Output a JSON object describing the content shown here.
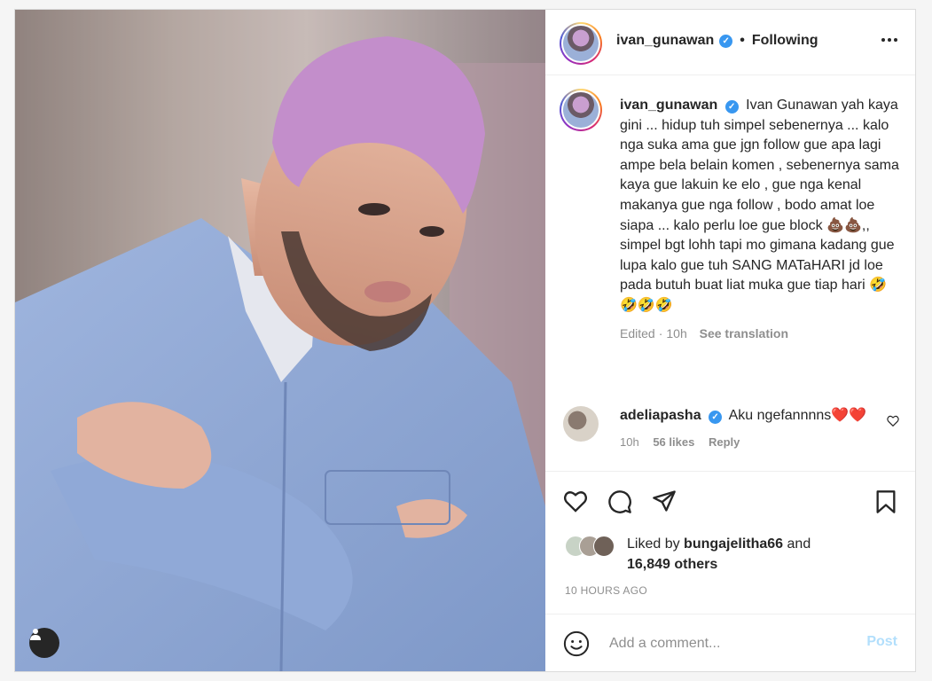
{
  "post": {
    "username": "ivan_gunawan",
    "follow_status": "Following",
    "caption_user": "ivan_gunawan",
    "caption_text": "Ivan Gunawan yah kaya gini ... hidup tuh simpel sebenernya ... kalo nga suka ama gue jgn follow gue apa lagi ampe bela belain komen , sebenernya sama kaya gue lakuin ke elo , gue nga kenal makanya gue nga follow , bodo amat loe siapa ... kalo perlu loe gue block 💩💩,, simpel bgt lohh tapi mo gimana kadang gue lupa kalo gue tuh SANG MATaHARI jd loe pada butuh buat liat muka gue tiap hari 🤣🤣🤣🤣",
    "edited_label": "Edited",
    "edited_time": "10h",
    "see_translation": "See translation",
    "comment": {
      "user": "adeliapasha",
      "text": "Aku ngefannnns❤️❤️",
      "time": "10h",
      "likes": "56 likes",
      "reply": "Reply"
    },
    "liked_by_prefix": "Liked by",
    "liked_by_user": "bungajelitha66",
    "liked_by_and": "and",
    "liked_by_others": "16,849 others",
    "timestamp": "10 HOURS AGO",
    "add_comment_placeholder": "Add a comment...",
    "post_button": "Post"
  },
  "icons": {
    "like": "heart-icon",
    "comment": "comment-bubble-icon",
    "share": "paper-plane-icon",
    "save": "bookmark-icon",
    "emoji": "smiley-icon",
    "more": "more-horizontal-icon",
    "tag": "user-tag-icon"
  },
  "colors": {
    "verified": "#3897f0",
    "post_button_disabled": "#b2dffc",
    "muted": "#8e8e8e"
  }
}
